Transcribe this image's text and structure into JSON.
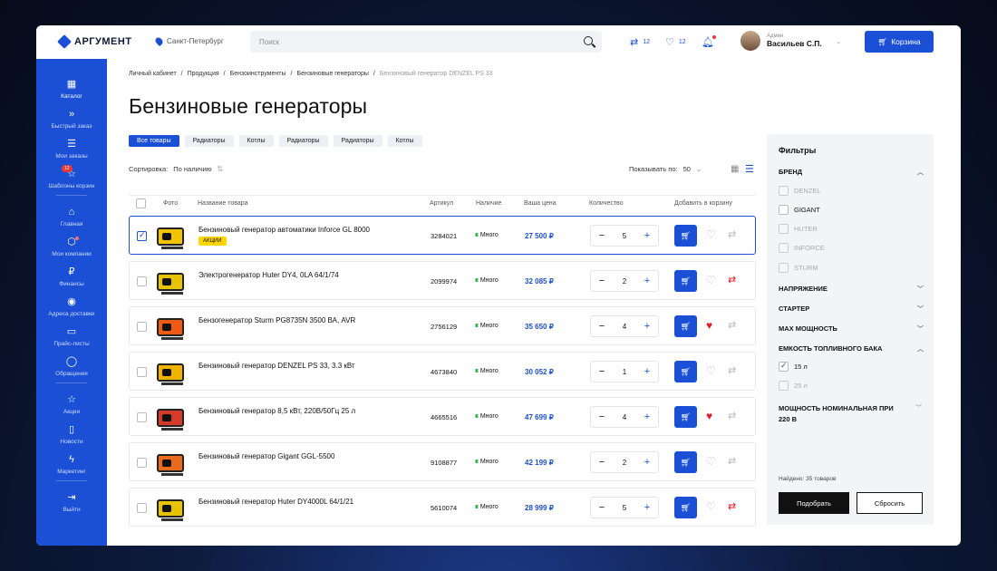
{
  "header": {
    "logo": "АРГУМЕНТ",
    "city": "Санкт-Петербург",
    "search_placeholder": "Поиск",
    "compare_count": "12",
    "favorites_count": "12",
    "user_role": "Админ",
    "user_name": "Васильев С.П.",
    "cart_label": "Корзина",
    "icons": [
      "cube-logo-icon",
      "pin-icon",
      "search-icon",
      "compare-icon",
      "heart-icon",
      "bell-icon",
      "cart-icon"
    ]
  },
  "sidebar": {
    "items": [
      {
        "label": "Каталог",
        "icon": "grid-icon"
      },
      {
        "label": "Быстрый заказ",
        "icon": "fast-forward-icon"
      },
      {
        "label": "Мои заказы",
        "icon": "list-icon"
      },
      {
        "label": "Шаблоны корзин",
        "icon": "bookmark-icon",
        "badge": "12"
      },
      {
        "label": "Главная",
        "icon": "home-icon"
      },
      {
        "label": "Мои компании",
        "icon": "box-icon"
      },
      {
        "label": "Финансы",
        "icon": "ruble-icon"
      },
      {
        "label": "Адреса доставки",
        "icon": "location-icon"
      },
      {
        "label": "Прайс-листы",
        "icon": "document-icon"
      },
      {
        "label": "Обращения",
        "icon": "chat-icon"
      },
      {
        "label": "Акции",
        "icon": "star-icon"
      },
      {
        "label": "Новости",
        "icon": "book-icon"
      },
      {
        "label": "Маркетинг",
        "icon": "lightning-icon"
      },
      {
        "label": "Выйти",
        "icon": "logout-icon"
      }
    ]
  },
  "breadcrumbs": [
    "Личный кабинет",
    "Продукция",
    "Бензоинструменты",
    "Бензиновые генераторы",
    "Бензиновый генератор DENZEL PS 33"
  ],
  "page_title": "Бензиновые генераторы",
  "chips": [
    "Все товары",
    "Радиаторы",
    "Котлы",
    "Радиаторы",
    "Радиаторы",
    "Котлы"
  ],
  "sort": {
    "label": "Сортировка:",
    "value": "По наличию"
  },
  "per_page": {
    "label": "Показывать по:",
    "value": "50"
  },
  "table": {
    "headers": {
      "photo": "Фото",
      "name": "Название товара",
      "sku": "Артикул",
      "stock": "Наличие",
      "price": "Ваша цена",
      "qty": "Количество",
      "add": "Добавить в корзину"
    },
    "rows": [
      {
        "name": "Бензиновый генератор автоматики Inforce GL 8000",
        "promo": "АКЦИИ",
        "sku": "3284021",
        "stock": "Много",
        "price": "27 500 ₽",
        "qty": "5",
        "favorite": false,
        "compare": false,
        "selected": true,
        "color": "#f2c400"
      },
      {
        "name": "Электрогенератор Huter DY4, 0LA 64/1/74",
        "promo": "",
        "sku": "2099974",
        "stock": "Много",
        "price": "32 085 ₽",
        "qty": "2",
        "favorite": false,
        "compare": true,
        "selected": false,
        "color": "#e8c400"
      },
      {
        "name": "Бензогенератор Sturm PG8735N 3500 ВА, AVR",
        "promo": "",
        "sku": "2756129",
        "stock": "Много",
        "price": "35 650 ₽",
        "qty": "4",
        "favorite": true,
        "compare": false,
        "selected": false,
        "color": "#ee5a14"
      },
      {
        "name": "Бензиновый генератор DENZEL PS 33, 3.3 кВт",
        "promo": "",
        "sku": "4673840",
        "stock": "Много",
        "price": "30 052 ₽",
        "qty": "1",
        "favorite": false,
        "compare": false,
        "selected": false,
        "color": "#f0b400"
      },
      {
        "name": "Бензиновый генератор 8,5 кВт, 220В/50Гц 25 л",
        "promo": "",
        "sku": "4665516",
        "stock": "Много",
        "price": "47 699 ₽",
        "qty": "4",
        "favorite": true,
        "compare": false,
        "selected": false,
        "color": "#d63a2a"
      },
      {
        "name": "Бензиновый генератор Gigant GGL-5500",
        "promo": "",
        "sku": "9108877",
        "stock": "Много",
        "price": "42 199 ₽",
        "qty": "2",
        "favorite": false,
        "compare": false,
        "selected": false,
        "color": "#e86a1a"
      },
      {
        "name": "Бензиновый генератор Huter DY4000L 64/1/21",
        "promo": "",
        "sku": "5610074",
        "stock": "Много",
        "price": "28 999 ₽",
        "qty": "5",
        "favorite": false,
        "compare": true,
        "selected": false,
        "color": "#e8c400"
      }
    ]
  },
  "filters": {
    "title": "Фильтры",
    "brand_label": "БРЕНД",
    "brands": [
      {
        "label": "DENZEL",
        "enabled": false
      },
      {
        "label": "GIGANT",
        "enabled": true
      },
      {
        "label": "HUTER",
        "enabled": false
      },
      {
        "label": "INFORCE",
        "enabled": false
      },
      {
        "label": "STURM",
        "enabled": false
      }
    ],
    "voltage": "НАПРЯЖЕНИЕ",
    "starter": "СТАРТЕР",
    "max_power": "MAX МОЩНОСТЬ",
    "tank_label": "ЕМКОСТЬ ТОПЛИВНОГО БАКА",
    "tank_options": [
      {
        "label": "15 л",
        "enabled": true,
        "checked": true
      },
      {
        "label": "25 л",
        "enabled": false,
        "checked": false
      }
    ],
    "nominal_power": "МОЩНОСТЬ НОМИНАЛЬНАЯ ПРИ 220 В",
    "found": "Найдено: 35 товаров",
    "apply": "Подобрать",
    "reset": "Сбросить"
  },
  "colors": {
    "accent": "#1a4fd6",
    "promo": "#ffd600",
    "favorite": "#e21c2a",
    "in_stock": "#2bb24c"
  }
}
